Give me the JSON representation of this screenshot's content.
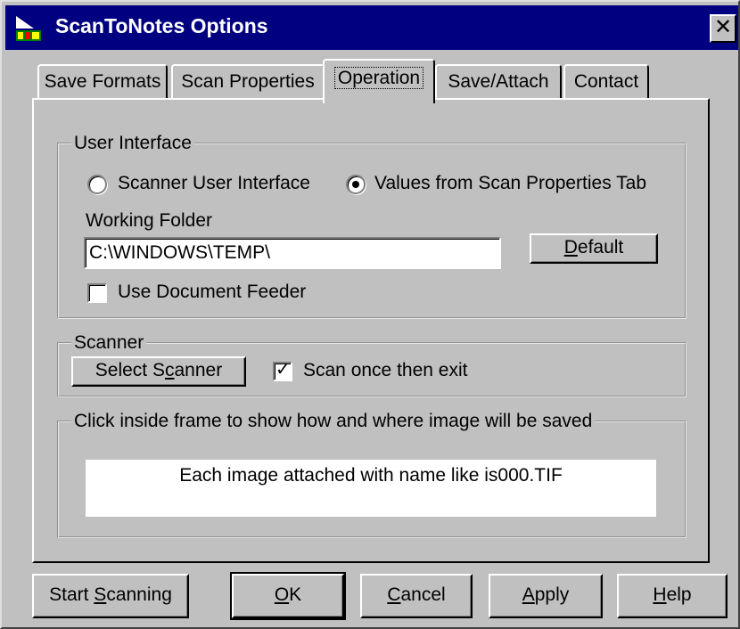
{
  "window": {
    "title": "ScanToNotes Options",
    "close_glyph": "✕"
  },
  "tabs": [
    {
      "label": "Save Formats",
      "active": false
    },
    {
      "label": "Scan Properties",
      "active": false
    },
    {
      "label": "Operation",
      "active": true
    },
    {
      "label": "Save/Attach",
      "active": false
    },
    {
      "label": "Contact",
      "active": false
    }
  ],
  "user_interface": {
    "title": "User Interface",
    "radio_scanner_ui": "Scanner User Interface",
    "radio_values": "Values from Scan Properties Tab",
    "selected": "radio_values",
    "working_folder_label": "Working Folder",
    "working_folder_value": "C:\\WINDOWS\\TEMP\\",
    "default_button": {
      "pre": "",
      "acc": "D",
      "post": "efault"
    },
    "use_feeder_label": "Use Document Feeder",
    "use_feeder_checked": false
  },
  "scanner": {
    "title": "Scanner",
    "select_button": {
      "pre": "Select S",
      "acc": "c",
      "post": "anner"
    },
    "scan_once_label": "Scan once then exit",
    "scan_once_checked": true
  },
  "preview": {
    "title": "Click inside frame to show how and where image will be saved",
    "text": "Each image attached with name like is000.TIF"
  },
  "buttons": {
    "start": {
      "pre": "Start ",
      "acc": "S",
      "post": "canning"
    },
    "ok": {
      "pre": "",
      "acc": "O",
      "post": "K"
    },
    "cancel": {
      "pre": "",
      "acc": "C",
      "post": "ancel"
    },
    "apply": {
      "pre": "",
      "acc": "A",
      "post": "pply"
    },
    "help": {
      "pre": "",
      "acc": "H",
      "post": "elp"
    }
  },
  "check_glyph": "✓",
  "icons": {
    "app": "scanner-app-icon",
    "close": "close-icon"
  },
  "colors": {
    "face": "#c0c0c0",
    "titlebar": "#000080",
    "title_text": "#ffffff"
  }
}
